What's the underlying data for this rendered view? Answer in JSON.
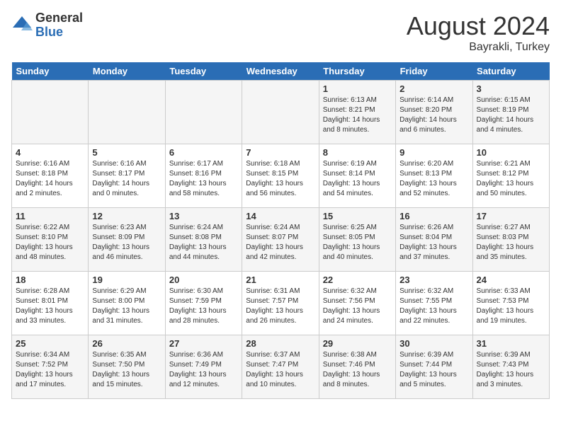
{
  "header": {
    "logo_general": "General",
    "logo_blue": "Blue",
    "month_year": "August 2024",
    "location": "Bayrakli, Turkey"
  },
  "days_of_week": [
    "Sunday",
    "Monday",
    "Tuesday",
    "Wednesday",
    "Thursday",
    "Friday",
    "Saturday"
  ],
  "weeks": [
    [
      {
        "day": "",
        "info": ""
      },
      {
        "day": "",
        "info": ""
      },
      {
        "day": "",
        "info": ""
      },
      {
        "day": "",
        "info": ""
      },
      {
        "day": "1",
        "info": "Sunrise: 6:13 AM\nSunset: 8:21 PM\nDaylight: 14 hours\nand 8 minutes."
      },
      {
        "day": "2",
        "info": "Sunrise: 6:14 AM\nSunset: 8:20 PM\nDaylight: 14 hours\nand 6 minutes."
      },
      {
        "day": "3",
        "info": "Sunrise: 6:15 AM\nSunset: 8:19 PM\nDaylight: 14 hours\nand 4 minutes."
      }
    ],
    [
      {
        "day": "4",
        "info": "Sunrise: 6:16 AM\nSunset: 8:18 PM\nDaylight: 14 hours\nand 2 minutes."
      },
      {
        "day": "5",
        "info": "Sunrise: 6:16 AM\nSunset: 8:17 PM\nDaylight: 14 hours\nand 0 minutes."
      },
      {
        "day": "6",
        "info": "Sunrise: 6:17 AM\nSunset: 8:16 PM\nDaylight: 13 hours\nand 58 minutes."
      },
      {
        "day": "7",
        "info": "Sunrise: 6:18 AM\nSunset: 8:15 PM\nDaylight: 13 hours\nand 56 minutes."
      },
      {
        "day": "8",
        "info": "Sunrise: 6:19 AM\nSunset: 8:14 PM\nDaylight: 13 hours\nand 54 minutes."
      },
      {
        "day": "9",
        "info": "Sunrise: 6:20 AM\nSunset: 8:13 PM\nDaylight: 13 hours\nand 52 minutes."
      },
      {
        "day": "10",
        "info": "Sunrise: 6:21 AM\nSunset: 8:12 PM\nDaylight: 13 hours\nand 50 minutes."
      }
    ],
    [
      {
        "day": "11",
        "info": "Sunrise: 6:22 AM\nSunset: 8:10 PM\nDaylight: 13 hours\nand 48 minutes."
      },
      {
        "day": "12",
        "info": "Sunrise: 6:23 AM\nSunset: 8:09 PM\nDaylight: 13 hours\nand 46 minutes."
      },
      {
        "day": "13",
        "info": "Sunrise: 6:24 AM\nSunset: 8:08 PM\nDaylight: 13 hours\nand 44 minutes."
      },
      {
        "day": "14",
        "info": "Sunrise: 6:24 AM\nSunset: 8:07 PM\nDaylight: 13 hours\nand 42 minutes."
      },
      {
        "day": "15",
        "info": "Sunrise: 6:25 AM\nSunset: 8:05 PM\nDaylight: 13 hours\nand 40 minutes."
      },
      {
        "day": "16",
        "info": "Sunrise: 6:26 AM\nSunset: 8:04 PM\nDaylight: 13 hours\nand 37 minutes."
      },
      {
        "day": "17",
        "info": "Sunrise: 6:27 AM\nSunset: 8:03 PM\nDaylight: 13 hours\nand 35 minutes."
      }
    ],
    [
      {
        "day": "18",
        "info": "Sunrise: 6:28 AM\nSunset: 8:01 PM\nDaylight: 13 hours\nand 33 minutes."
      },
      {
        "day": "19",
        "info": "Sunrise: 6:29 AM\nSunset: 8:00 PM\nDaylight: 13 hours\nand 31 minutes."
      },
      {
        "day": "20",
        "info": "Sunrise: 6:30 AM\nSunset: 7:59 PM\nDaylight: 13 hours\nand 28 minutes."
      },
      {
        "day": "21",
        "info": "Sunrise: 6:31 AM\nSunset: 7:57 PM\nDaylight: 13 hours\nand 26 minutes."
      },
      {
        "day": "22",
        "info": "Sunrise: 6:32 AM\nSunset: 7:56 PM\nDaylight: 13 hours\nand 24 minutes."
      },
      {
        "day": "23",
        "info": "Sunrise: 6:32 AM\nSunset: 7:55 PM\nDaylight: 13 hours\nand 22 minutes."
      },
      {
        "day": "24",
        "info": "Sunrise: 6:33 AM\nSunset: 7:53 PM\nDaylight: 13 hours\nand 19 minutes."
      }
    ],
    [
      {
        "day": "25",
        "info": "Sunrise: 6:34 AM\nSunset: 7:52 PM\nDaylight: 13 hours\nand 17 minutes."
      },
      {
        "day": "26",
        "info": "Sunrise: 6:35 AM\nSunset: 7:50 PM\nDaylight: 13 hours\nand 15 minutes."
      },
      {
        "day": "27",
        "info": "Sunrise: 6:36 AM\nSunset: 7:49 PM\nDaylight: 13 hours\nand 12 minutes."
      },
      {
        "day": "28",
        "info": "Sunrise: 6:37 AM\nSunset: 7:47 PM\nDaylight: 13 hours\nand 10 minutes."
      },
      {
        "day": "29",
        "info": "Sunrise: 6:38 AM\nSunset: 7:46 PM\nDaylight: 13 hours\nand 8 minutes."
      },
      {
        "day": "30",
        "info": "Sunrise: 6:39 AM\nSunset: 7:44 PM\nDaylight: 13 hours\nand 5 minutes."
      },
      {
        "day": "31",
        "info": "Sunrise: 6:39 AM\nSunset: 7:43 PM\nDaylight: 13 hours\nand 3 minutes."
      }
    ]
  ]
}
